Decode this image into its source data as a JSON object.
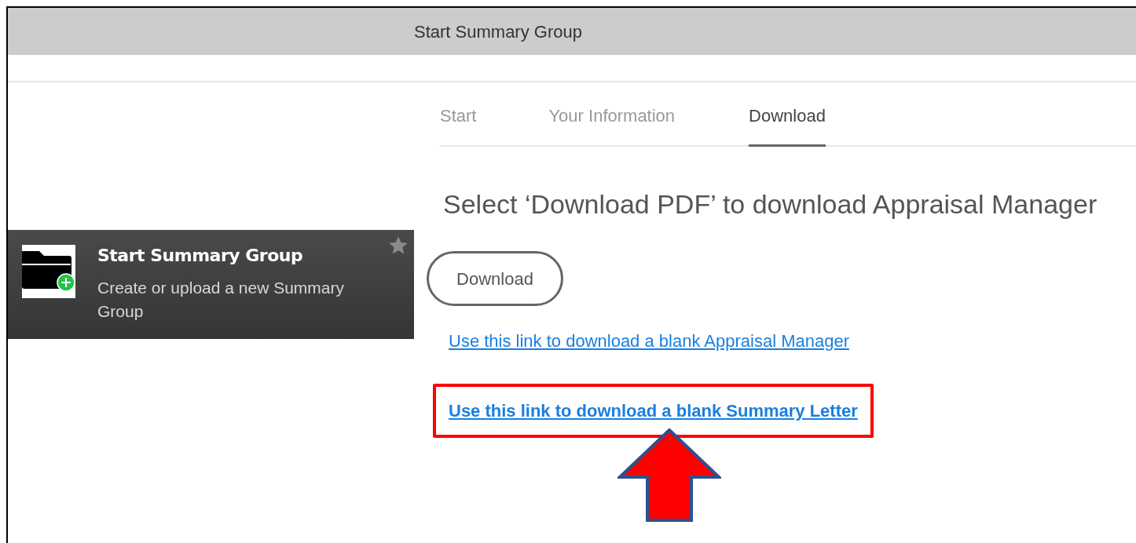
{
  "window": {
    "title": "Start Summary Group"
  },
  "tile": {
    "title": "Start Summary Group",
    "description": "Create or upload a new Summary Group"
  },
  "tabs": [
    {
      "label": "Start",
      "selected": false
    },
    {
      "label": "Your Information",
      "selected": false
    },
    {
      "label": "Download",
      "selected": true
    }
  ],
  "heading": "Select ‘Download PDF’ to download Appraisal Manager",
  "download_button": "Download",
  "links": [
    {
      "label": "Use this link to download a blank Appraisal Manager",
      "highlighted": false
    },
    {
      "label": "Use this link to download a blank Summary Letter",
      "highlighted": true
    }
  ]
}
